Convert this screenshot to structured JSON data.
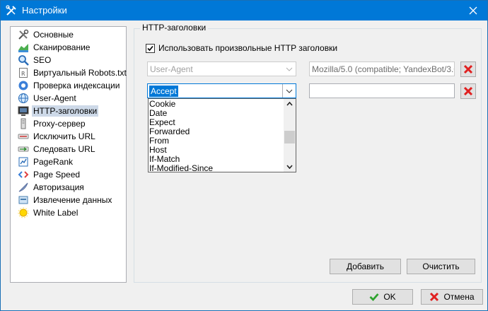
{
  "window": {
    "title": "Настройки"
  },
  "sidebar": {
    "items": [
      {
        "label": "Основные",
        "icon": "tools-icon"
      },
      {
        "label": "Сканирование",
        "icon": "chart-icon"
      },
      {
        "label": "SEO",
        "icon": "magnifier-icon"
      },
      {
        "label": "Виртуальный Robots.txt",
        "icon": "robots-file-icon"
      },
      {
        "label": "Проверка индексации",
        "icon": "index-check-icon"
      },
      {
        "label": "User-Agent",
        "icon": "globe-icon"
      },
      {
        "label": "HTTP-заголовки",
        "icon": "monitor-icon",
        "selected": true
      },
      {
        "label": "Proxy-сервер",
        "icon": "proxy-icon"
      },
      {
        "label": "Исключить URL",
        "icon": "exclude-url-icon"
      },
      {
        "label": "Следовать URL",
        "icon": "follow-url-icon"
      },
      {
        "label": "PageRank",
        "icon": "pagerank-icon"
      },
      {
        "label": "Page Speed",
        "icon": "code-icon"
      },
      {
        "label": "Авторизация",
        "icon": "feather-icon"
      },
      {
        "label": "Извлечение данных",
        "icon": "extract-icon"
      },
      {
        "label": "White Label",
        "icon": "sun-icon"
      }
    ]
  },
  "panel": {
    "group_title": "HTTP-заголовки",
    "use_custom_label": "Использовать произвольные HTTP заголовки",
    "use_custom_checked": true,
    "row1": {
      "header": "User-Agent",
      "value": "Mozilla/5.0 (compatible; YandexBot/3.0; +"
    },
    "row2": {
      "header": "Accept",
      "value": ""
    },
    "dropdown_options": [
      "Cookie",
      "Date",
      "Expect",
      "Forwarded",
      "From",
      "Host",
      "If-Match",
      "If-Modified-Since"
    ],
    "add_label": "Добавить",
    "clear_label": "Очистить"
  },
  "footer": {
    "ok_label": "OK",
    "cancel_label": "Отмена"
  },
  "colors": {
    "titlebar": "#0078d7",
    "selection": "#0078d7",
    "delete_red": "#e02020",
    "ok_green": "#2ea32e"
  }
}
